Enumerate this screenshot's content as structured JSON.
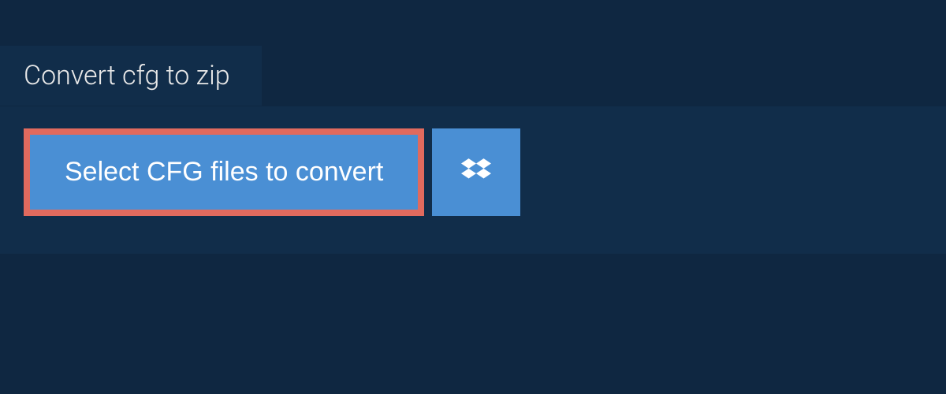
{
  "tab": {
    "label": "Convert cfg to zip"
  },
  "actions": {
    "select_label": "Select CFG files to convert"
  },
  "colors": {
    "background": "#0f2741",
    "panel": "#112d4a",
    "button": "#4a8fd4",
    "highlight": "#e16a5e"
  }
}
